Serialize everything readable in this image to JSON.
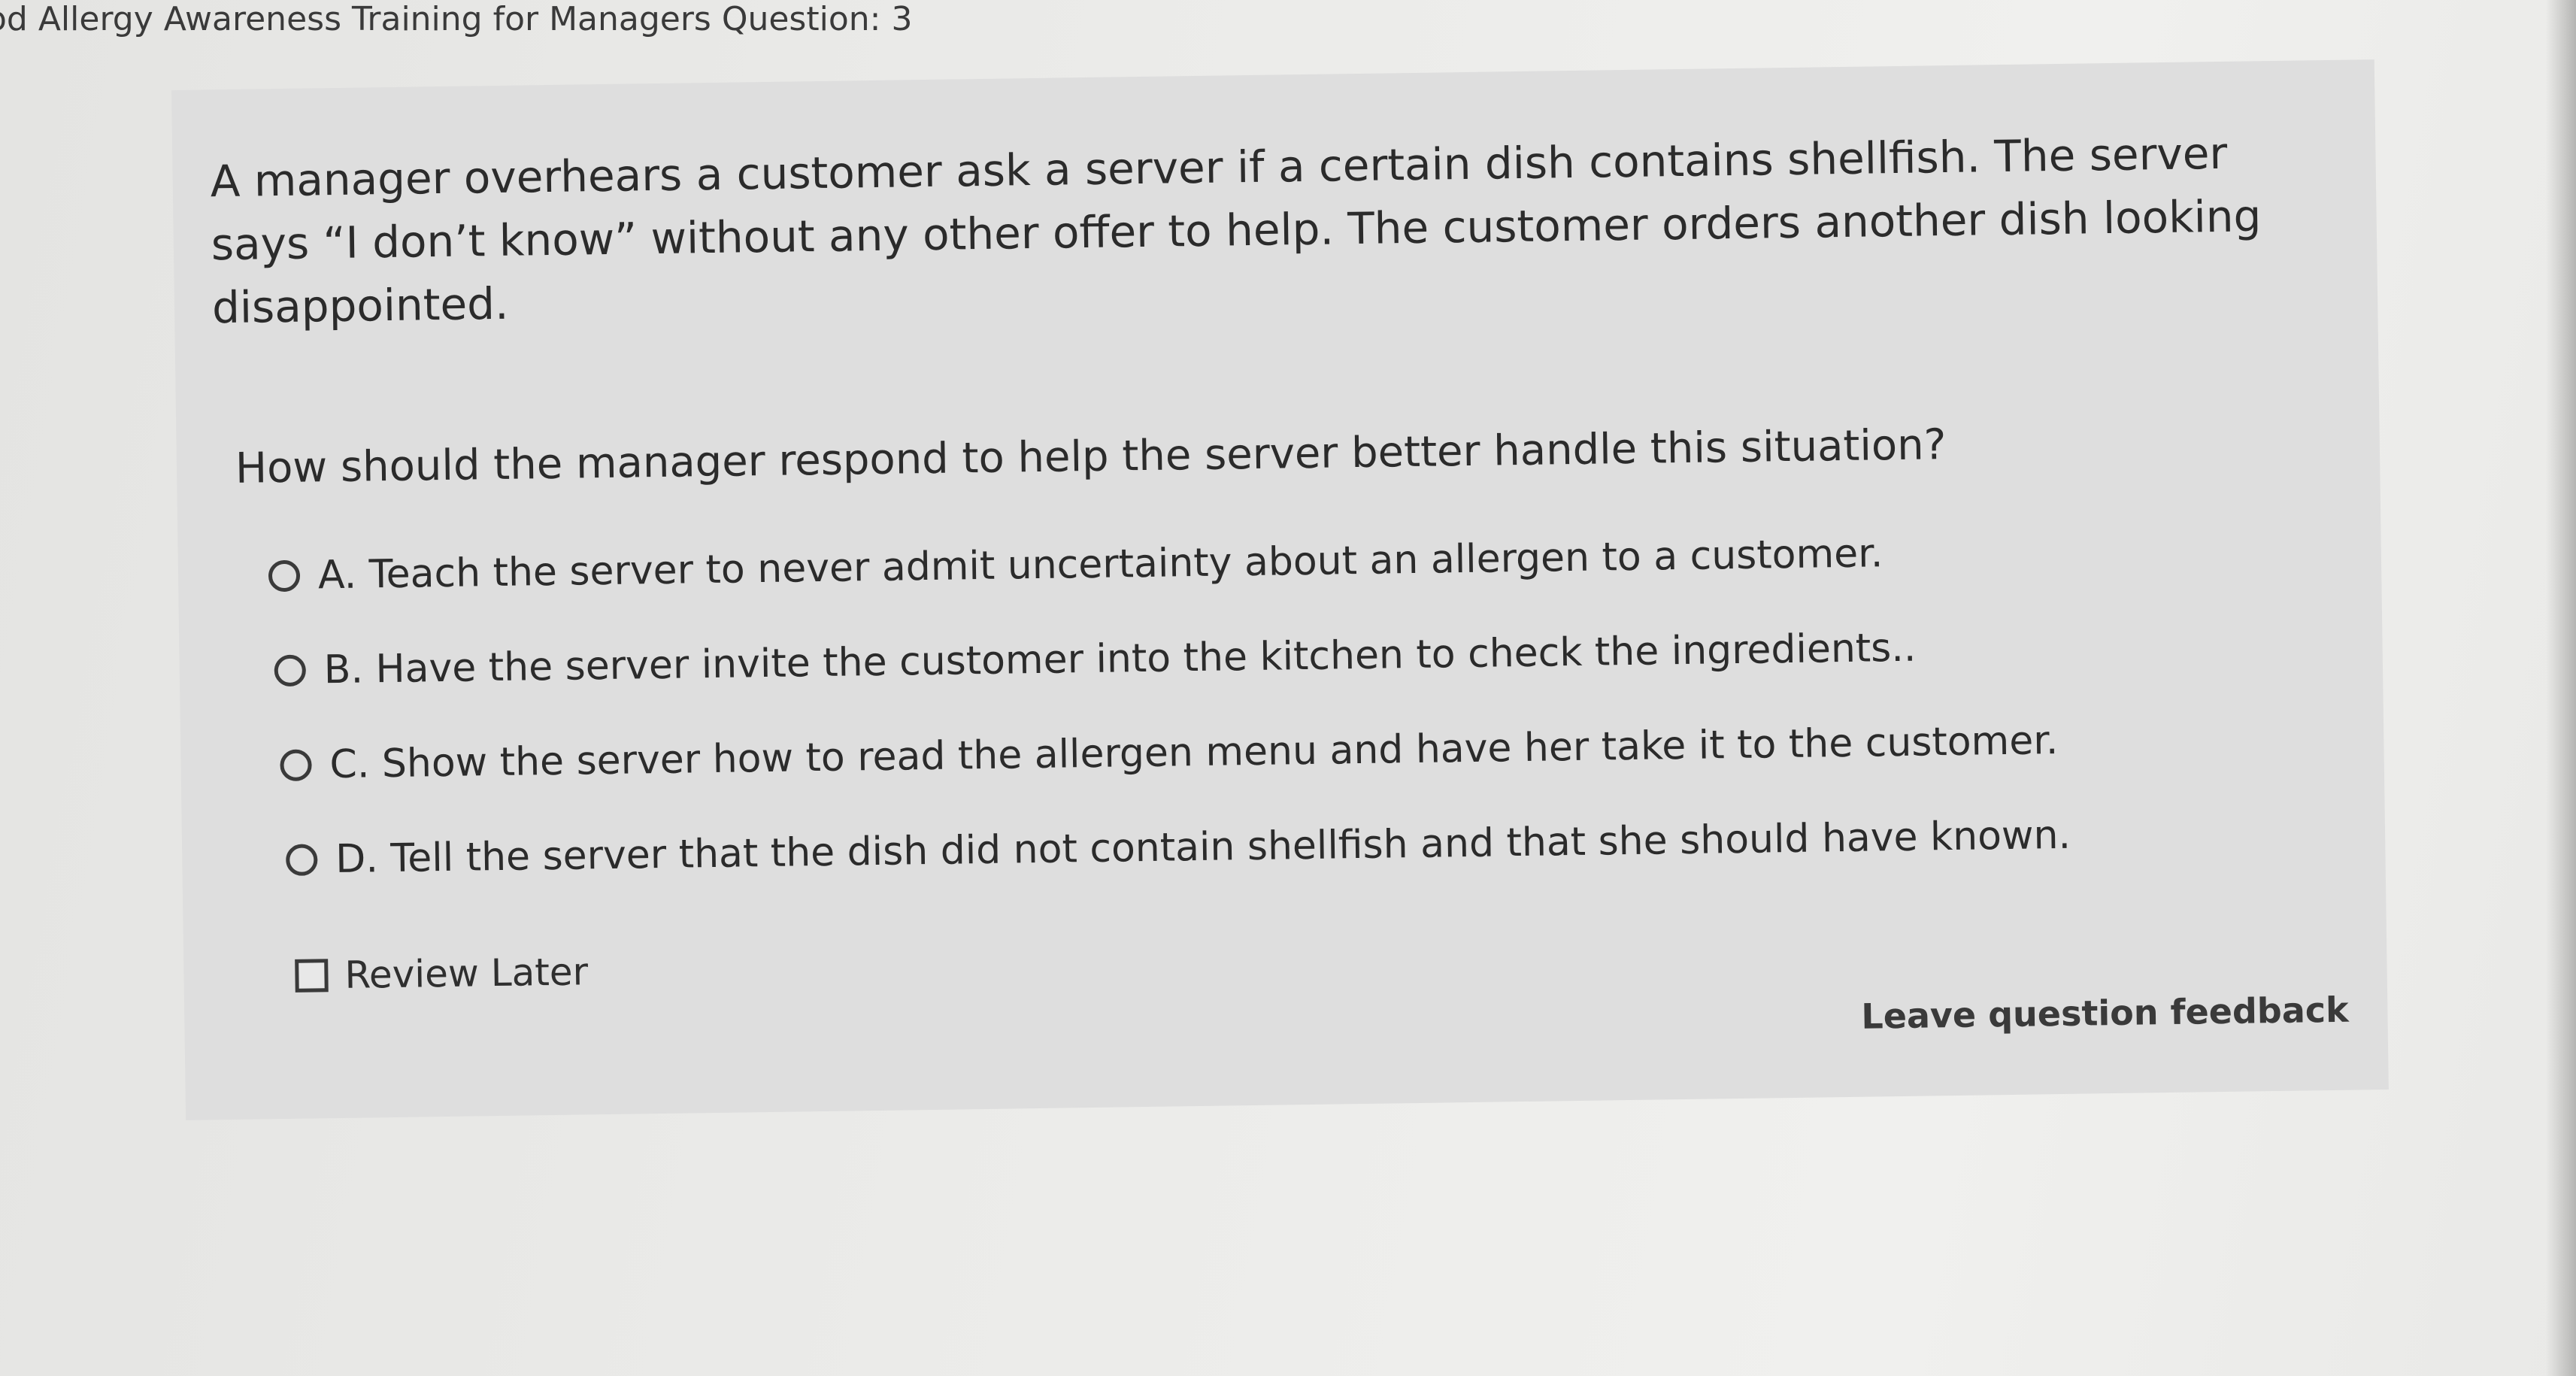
{
  "header": {
    "title": "od Allergy Awareness Training for Managers Question: 3"
  },
  "question": {
    "scenario": "A manager overhears a customer ask a server if a certain dish contains shellfish. The server says “I don’t know” without any other offer to help. The customer orders another dish looking disappointed.",
    "prompt": "How should the manager respond to help the server better handle this situation?",
    "options": [
      {
        "label": "A. Teach the server to never admit uncertainty about an allergen to a customer.",
        "selected": false
      },
      {
        "label": "B. Have the server invite the customer into the kitchen to check the ingredients..",
        "selected": false
      },
      {
        "label": "C. Show the server how to read the allergen menu and have her take it to the customer.",
        "selected": false
      },
      {
        "label": "D. Tell the server that the dish did not contain shellfish and that she should have known.",
        "selected": false
      }
    ],
    "review_later": {
      "label": "Review Later",
      "checked": false
    },
    "feedback_link": "Leave question feedback"
  },
  "colors": {
    "card_background": "#dedede",
    "text": "#2b2b2b"
  }
}
